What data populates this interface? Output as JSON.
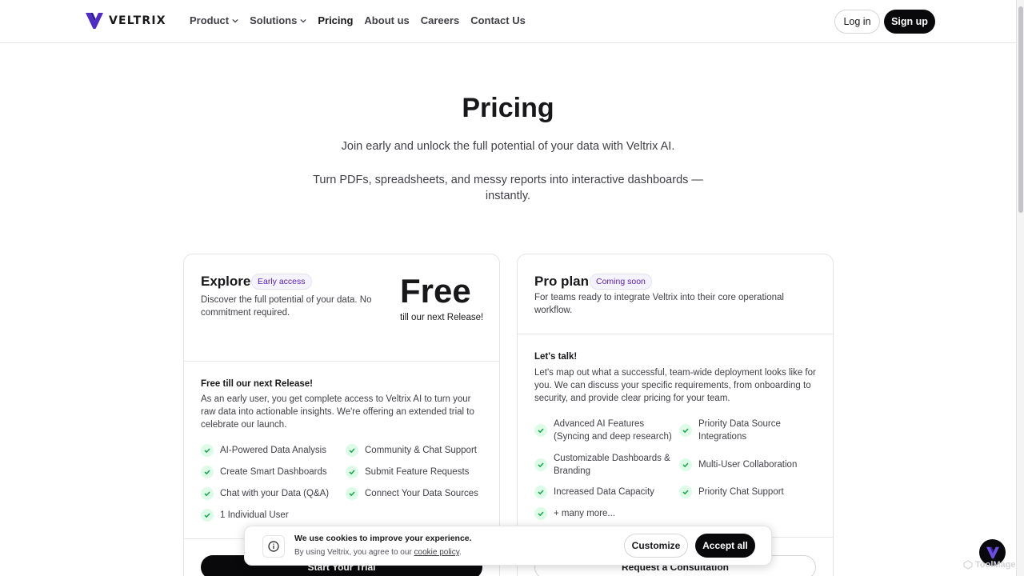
{
  "brand": {
    "name": "VELTRIX",
    "accent": "#4f2cc8",
    "accent_dark": "#2e1a8a"
  },
  "nav": {
    "items": [
      {
        "label": "Product",
        "dropdown": true,
        "active": false
      },
      {
        "label": "Solutions",
        "dropdown": true,
        "active": false
      },
      {
        "label": "Pricing",
        "dropdown": false,
        "active": true
      },
      {
        "label": "About us",
        "dropdown": false,
        "active": false
      },
      {
        "label": "Careers",
        "dropdown": false,
        "active": false
      },
      {
        "label": "Contact Us",
        "dropdown": false,
        "active": false
      }
    ],
    "login_label": "Log in",
    "signup_label": "Sign up"
  },
  "hero": {
    "title": "Pricing",
    "subtitle1": "Join early and unlock the full potential of your data with Veltrix AI.",
    "subtitle2": "Turn PDFs, spreadsheets, and messy reports into interactive dashboards — instantly."
  },
  "plans": {
    "explore": {
      "title": "Explore",
      "badge": "Early access",
      "description": "Discover the full potential of your data. No commitment required.",
      "price": "Free",
      "price_note": "till our next Release!",
      "section_title": "Free till our next Release!",
      "section_body": "As an early user, you get complete access to  Veltrix AI to turn your raw data into actionable insights. We're offering an extended trial to celebrate our launch.",
      "features": [
        "AI-Powered Data Analysis",
        "Community & Chat Support",
        "Create Smart Dashboards",
        "Submit Feature Requests",
        "Chat with your Data (Q&A)",
        "Connect Your Data Sources",
        "1 Individual User"
      ],
      "cta": "Start Your Trial"
    },
    "pro": {
      "title": "Pro plan",
      "badge": "Coming soon",
      "description": "For teams ready to integrate Veltrix into their core operational workflow.",
      "section_title": "Let's talk!",
      "section_body": "Let's map out what a successful, team-wide deployment looks like for you. We can discuss your specific requirements, from onboarding to security, and provide clear pricing for your team.",
      "features": [
        "Advanced AI Features (Syncing and deep research)",
        "Priority Data Source Integrations",
        "Customizable Dashboards & Branding",
        "Multi-User Collaboration",
        "Increased Data Capacity",
        "Priority Chat Support",
        "+ many more..."
      ],
      "cta": "Request a Consultation"
    }
  },
  "cookie": {
    "title": "We use cookies to improve your experience.",
    "text_prefix": "By using Veltrix, you agree to our ",
    "link_label": "cookie policy",
    "text_suffix": ".",
    "customize_label": "Customize",
    "accept_label": "Accept all"
  },
  "watermark": "ToolMage"
}
